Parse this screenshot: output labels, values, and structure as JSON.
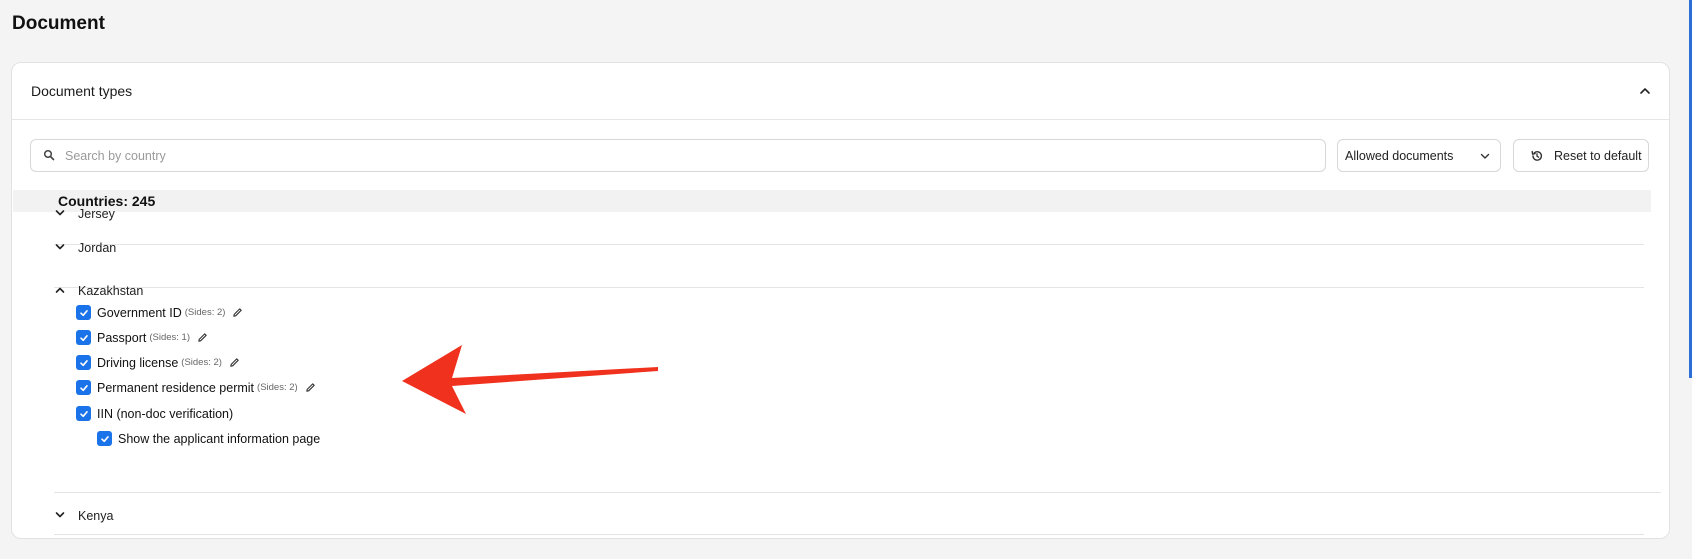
{
  "page": {
    "title": "Document"
  },
  "card": {
    "title": "Document types"
  },
  "toolbar": {
    "search_placeholder": "Search by country",
    "filter_selected": "Allowed documents",
    "reset_label": "Reset to default"
  },
  "countries": {
    "label": "Countries: 245"
  },
  "list": {
    "jersey": "Jersey",
    "jordan": "Jordan",
    "kazakhstan": "Kazakhstan",
    "kenya": "Kenya"
  },
  "documents": [
    {
      "label": "Government ID",
      "sides": "(Sides: 2)",
      "checked": true
    },
    {
      "label": "Passport",
      "sides": "(Sides: 1)",
      "checked": true
    },
    {
      "label": "Driving license",
      "sides": "(Sides: 2)",
      "checked": true
    },
    {
      "label": "Permanent residence permit",
      "sides": "(Sides: 2)",
      "checked": true
    },
    {
      "label": "IIN (non-doc verification)",
      "checked": true
    }
  ],
  "sub_option": {
    "label": "Show the applicant information page",
    "checked": true
  },
  "colors": {
    "accent": "#1a73e8",
    "annotation_arrow": "#f0311e"
  },
  "icons": {
    "search": "search-icon",
    "collapse": "chevron-up-icon",
    "select": "chevron-down-icon",
    "reset": "history-icon",
    "edit": "pencil-icon",
    "check": "check-icon"
  }
}
